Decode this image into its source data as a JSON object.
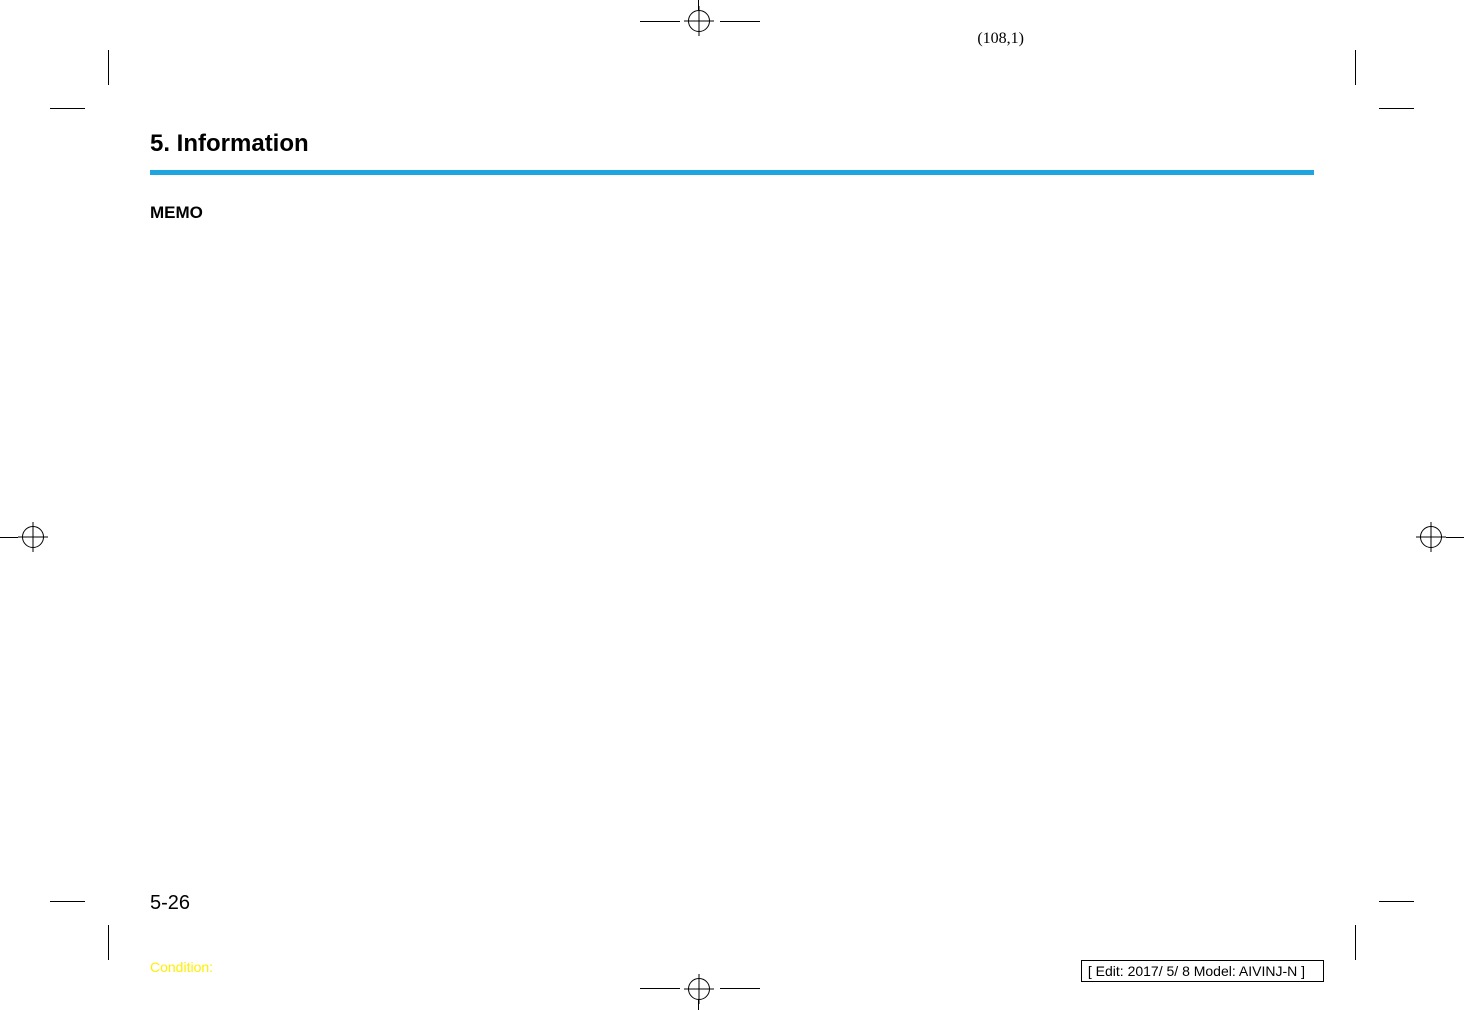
{
  "page": {
    "coordinate": "(108,1)",
    "section_title": "5. Information",
    "memo_label": "MEMO",
    "page_number": "5-26",
    "condition_label": "Condition:",
    "edit_info": "[ Edit: 2017/ 5/ 8   Model:  AIVINJ-N ]"
  },
  "colors": {
    "divider": "#1ea5e0",
    "condition_text": "#ffef00"
  }
}
